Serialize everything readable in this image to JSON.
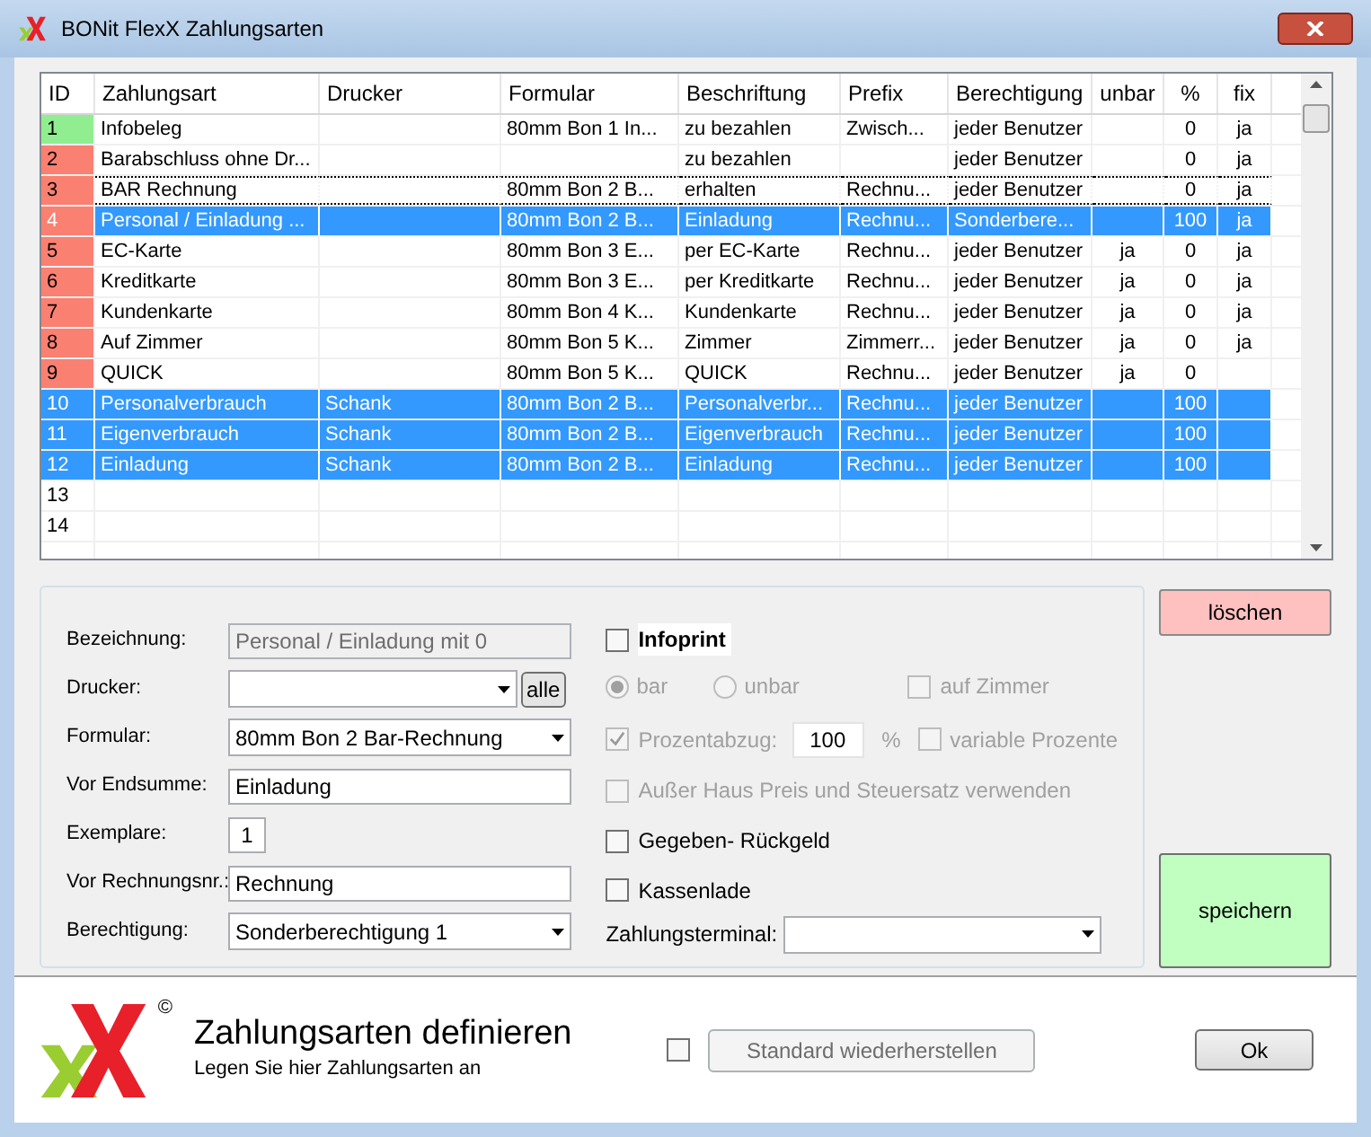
{
  "window": {
    "title": "BONit FlexX Zahlungsarten"
  },
  "table": {
    "columns": [
      "ID",
      "Zahlungsart",
      "Drucker",
      "Formular",
      "Beschriftung",
      "Prefix",
      "Berechtigung",
      "unbar",
      "%",
      "fix"
    ],
    "rows": [
      {
        "cells": [
          "1",
          "Infobeleg",
          "",
          "80mm Bon 1  In...",
          "zu bezahlen",
          "Zwisch...",
          "jeder Benutzer",
          "",
          "0",
          "ja"
        ],
        "color": "#90ee90",
        "selected": false,
        "focused": false
      },
      {
        "cells": [
          "2",
          "Barabschluss ohne Dr...",
          "",
          "",
          "zu bezahlen",
          "",
          "jeder Benutzer",
          "",
          "0",
          "ja"
        ],
        "color": "#fa8072",
        "selected": false,
        "focused": false
      },
      {
        "cells": [
          "3",
          "BAR Rechnung",
          "",
          "80mm Bon 2  B...",
          "erhalten",
          "Rechnu...",
          "jeder Benutzer",
          "",
          "0",
          "ja"
        ],
        "color": "#fa8072",
        "selected": false,
        "focused": true
      },
      {
        "cells": [
          "4",
          "Personal / Einladung ...",
          "",
          "80mm Bon 2  B...",
          "Einladung",
          "Rechnu...",
          "Sonderbere...",
          "",
          "100",
          "ja"
        ],
        "color": "#fa8072",
        "selected": true,
        "focused": false
      },
      {
        "cells": [
          "5",
          "EC-Karte",
          "",
          "80mm Bon 3  E...",
          "per EC-Karte",
          "Rechnu...",
          "jeder Benutzer",
          "ja",
          "0",
          "ja"
        ],
        "color": "#fa8072",
        "selected": false,
        "focused": false
      },
      {
        "cells": [
          "6",
          "Kreditkarte",
          "",
          "80mm Bon 3  E...",
          "per Kreditkarte",
          "Rechnu...",
          "jeder Benutzer",
          "ja",
          "0",
          "ja"
        ],
        "color": "#fa8072",
        "selected": false,
        "focused": false
      },
      {
        "cells": [
          "7",
          "Kundenkarte",
          "",
          "80mm Bon 4  K...",
          "Kundenkarte",
          "Rechnu...",
          "jeder Benutzer",
          "ja",
          "0",
          "ja"
        ],
        "color": "#fa8072",
        "selected": false,
        "focused": false
      },
      {
        "cells": [
          "8",
          "Auf Zimmer",
          "",
          "80mm Bon 5  K...",
          "Zimmer",
          "Zimmerr...",
          "jeder Benutzer",
          "ja",
          "0",
          "ja"
        ],
        "color": "#fa8072",
        "selected": false,
        "focused": false
      },
      {
        "cells": [
          "9",
          "QUICK",
          "",
          "80mm Bon 5  K...",
          "QUICK",
          "Rechnu...",
          "jeder Benutzer",
          "ja",
          "0",
          ""
        ],
        "color": "#fa8072",
        "selected": false,
        "focused": false
      },
      {
        "cells": [
          "10",
          "Personalverbrauch",
          "Schank",
          "80mm Bon 2  B...",
          "Personalverbr...",
          "Rechnu...",
          "jeder Benutzer",
          "",
          "100",
          ""
        ],
        "selected": true,
        "focused": false
      },
      {
        "cells": [
          "11",
          "Eigenverbrauch",
          "Schank",
          "80mm Bon 2  B...",
          "Eigenverbrauch",
          "Rechnu...",
          "jeder Benutzer",
          "",
          "100",
          ""
        ],
        "selected": true,
        "focused": false
      },
      {
        "cells": [
          "12",
          "Einladung",
          "Schank",
          "80mm Bon 2  B...",
          "Einladung",
          "Rechnu...",
          "jeder Benutzer",
          "",
          "100",
          ""
        ],
        "selected": true,
        "focused": false
      },
      {
        "cells": [
          "13",
          "",
          "",
          "",
          "",
          "",
          "",
          "",
          "",
          ""
        ],
        "selected": false,
        "focused": false
      },
      {
        "cells": [
          "14",
          "",
          "",
          "",
          "",
          "",
          "",
          "",
          "",
          ""
        ],
        "selected": false,
        "focused": false
      }
    ]
  },
  "form": {
    "fields": [
      {
        "label": "Bezeichnung:",
        "kind": "text",
        "value": "Personal / Einladung mit 0",
        "disabled": true
      },
      {
        "label": "Drucker:",
        "kind": "combo_button",
        "button": "alle"
      },
      {
        "label": "Formular:",
        "kind": "combo",
        "value": "80mm Bon 2  Bar-Rechnung"
      },
      {
        "label": "Vor Endsumme:",
        "kind": "text",
        "value": "Einladung",
        "disabled": false
      },
      {
        "label": "Exemplare:",
        "kind": "number",
        "value": "1"
      },
      {
        "label": "Vor Rechnungsnr.:",
        "kind": "text",
        "value": "Rechnung",
        "disabled": false
      },
      {
        "label": "Berechtigung:",
        "kind": "combo",
        "value": "Sonderberechtigung 1"
      }
    ]
  },
  "options": {
    "infoprint": {
      "label": "Infoprint",
      "checked": false,
      "disabled": false
    },
    "payment": [
      {
        "label": "bar",
        "selected": true
      },
      {
        "label": "unbar",
        "selected": false
      }
    ],
    "payment_disabled": true,
    "auf_zimmer": {
      "label": "auf Zimmer",
      "checked": false,
      "disabled": true
    },
    "prozentabzug": {
      "label": "Prozentabzug:",
      "checked": true,
      "disabled": true,
      "value": "100",
      "unit": "%"
    },
    "variable_prozente": {
      "label": "variable Prozente",
      "checked": false,
      "disabled": true
    },
    "ausser_haus": {
      "label": "Außer Haus Preis und Steuersatz verwenden",
      "checked": false,
      "disabled": true
    },
    "gegeben": {
      "label": "Gegeben- Rückgeld",
      "checked": false,
      "disabled": false
    },
    "kassenlade": {
      "label": "Kassenlade",
      "checked": false,
      "disabled": false
    },
    "zahlungsterminal": {
      "label": "Zahlungsterminal:"
    }
  },
  "buttons": {
    "delete": "löschen",
    "save": "speichern"
  },
  "footer": {
    "copyright": "©",
    "title": "Zahlungsarten definieren",
    "subtitle": "Legen Sie hier Zahlungsarten an",
    "restore": {
      "label": "Standard wiederherstellen",
      "checked": false,
      "disabled": true
    },
    "ok": "Ok"
  }
}
